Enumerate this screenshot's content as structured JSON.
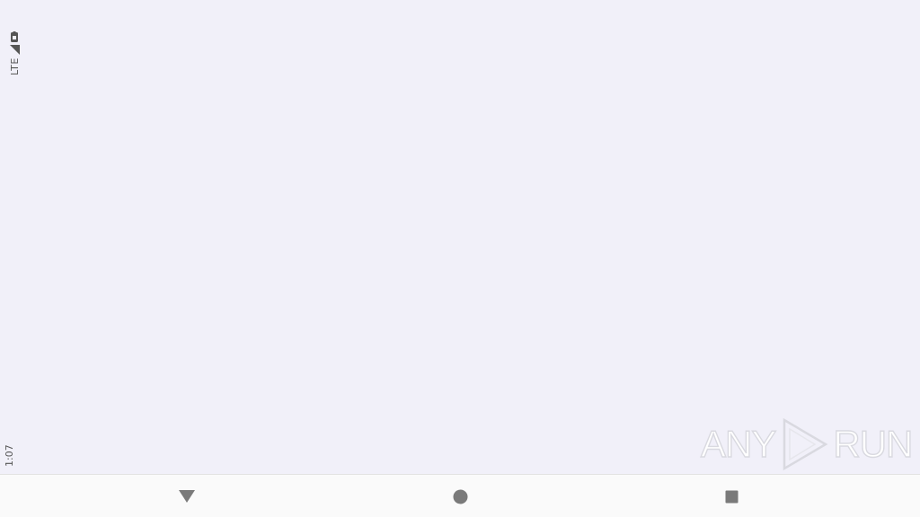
{
  "status_bar": {
    "network": "LTE",
    "time": "1:07",
    "icons": [
      "signal-icon",
      "battery-icon"
    ]
  },
  "watermark": {
    "left_text": "ANY",
    "right_text": "RUN",
    "icon": "play-triangle-icon"
  },
  "nav_bar": {
    "buttons": [
      "back-icon",
      "home-icon",
      "recents-icon"
    ],
    "icon_color": "#7a7a7a"
  },
  "colors": {
    "screen_background": "#f1f0f9",
    "nav_background": "#fafafa",
    "status_text": "#555555"
  }
}
